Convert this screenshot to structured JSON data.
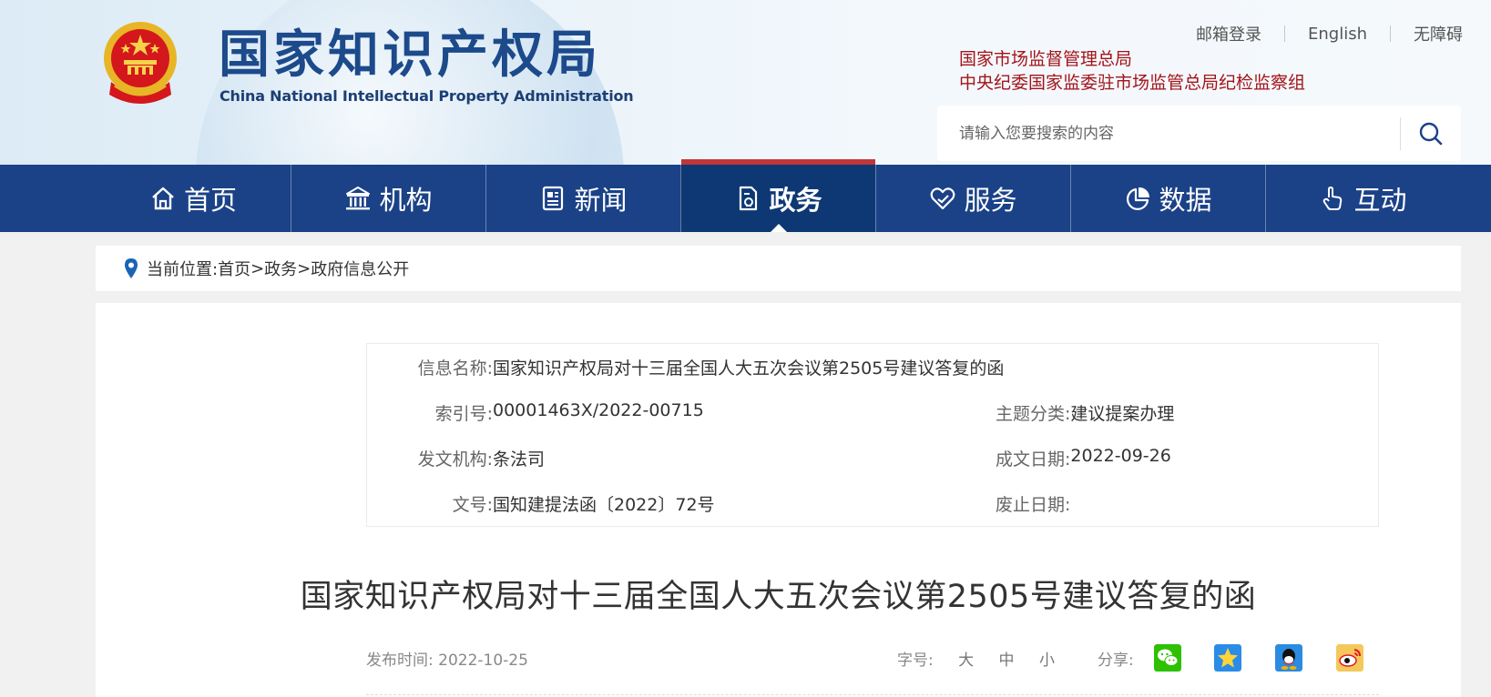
{
  "header": {
    "logo_cn": "国家知识产权局",
    "logo_en": "China National Intellectual Property Administration",
    "top_links": [
      "邮箱登录",
      "English",
      "无障碍"
    ],
    "agency_links": [
      "国家市场监督管理总局",
      "中央纪委国家监委驻市场监管总局纪检监察组"
    ],
    "search_placeholder": "请输入您要搜索的内容"
  },
  "nav": {
    "items": [
      {
        "label": "首页",
        "icon": "home-icon"
      },
      {
        "label": "机构",
        "icon": "institution-icon"
      },
      {
        "label": "新闻",
        "icon": "news-icon"
      },
      {
        "label": "政务",
        "icon": "government-affairs-icon",
        "active": true
      },
      {
        "label": "服务",
        "icon": "service-icon"
      },
      {
        "label": "数据",
        "icon": "data-pie-icon"
      },
      {
        "label": "互动",
        "icon": "interaction-hand-icon"
      }
    ]
  },
  "breadcrumb": {
    "prefix": "当前位置:",
    "items": [
      "首页",
      "政务",
      "政府信息公开"
    ],
    "separator": ">"
  },
  "info": {
    "name_label": "信息名称:",
    "name_value": "国家知识产权局对十三届全国人大五次会议第2505号建议答复的函",
    "index_label": "索引号:",
    "index_value": "00001463X/2022-00715",
    "topic_label": "主题分类:",
    "topic_value": "建议提案办理",
    "issuer_label": "发文机构:",
    "issuer_value": "条法司",
    "date_label": "成文日期:",
    "date_value": "2022-09-26",
    "docno_label": "文号:",
    "docno_value": "国知建提法函〔2022〕72号",
    "abolish_label": "废止日期:",
    "abolish_value": ""
  },
  "article": {
    "title": "国家知识产权局对十三届全国人大五次会议第2505号建议答复的函",
    "publish_label": "发布时间:",
    "publish_date": "2022-10-25",
    "fontsize_label": "字号:",
    "fontsize_options": [
      "大",
      "中",
      "小"
    ],
    "share_label": "分享:",
    "share_targets": [
      "wechat-icon",
      "qzone-icon",
      "qq-icon",
      "weibo-icon"
    ]
  },
  "colors": {
    "nav_bg": "#1b4287",
    "nav_active": "#0e3873",
    "accent_red": "#a3141a",
    "logo_blue": "#1c4a8b"
  }
}
